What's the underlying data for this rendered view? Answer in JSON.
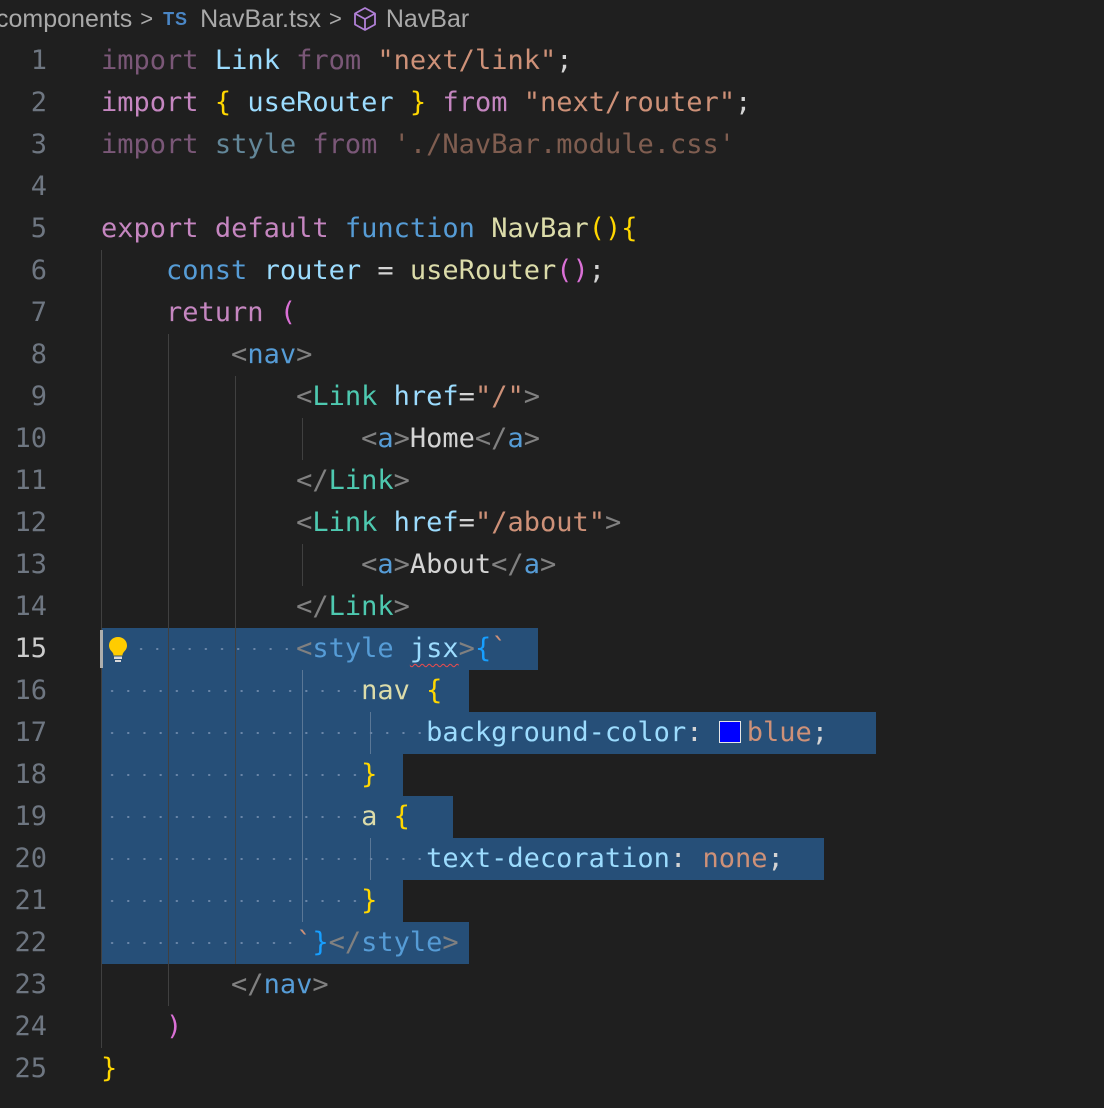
{
  "breadcrumb": {
    "folder": "components",
    "file_badge": "TS",
    "file": "NavBar.tsx",
    "symbol": "NavBar"
  },
  "editor": {
    "active_line": 15,
    "selection_color": "#264f78",
    "line_numbers": [
      "1",
      "2",
      "3",
      "4",
      "5",
      "6",
      "7",
      "8",
      "9",
      "10",
      "11",
      "12",
      "13",
      "14",
      "15",
      "16",
      "17",
      "18",
      "19",
      "20",
      "21",
      "22",
      "23",
      "24",
      "25"
    ],
    "lines": [
      [
        "import",
        " ",
        "Link",
        " ",
        "from",
        " ",
        "\"next/link\"",
        ";"
      ],
      [
        "import",
        " ",
        "{",
        " ",
        "useRouter",
        " ",
        "}",
        " ",
        "from",
        " ",
        "\"next/router\"",
        ";"
      ],
      [
        "import",
        " ",
        "style",
        " ",
        "from",
        " ",
        "'./NavBar.module.css'"
      ],
      [],
      [
        "export",
        " ",
        "default",
        " ",
        "function",
        " ",
        "NavBar",
        "(",
        ")",
        "{"
      ],
      [
        "    ",
        "const",
        " ",
        "router",
        " ",
        "=",
        " ",
        "useRouter",
        "(",
        ")",
        ";"
      ],
      [
        "    ",
        "return",
        " ",
        "("
      ],
      [
        "        ",
        "<",
        "nav",
        ">"
      ],
      [
        "            ",
        "<",
        "Link",
        " ",
        "href",
        "=",
        "\"/\"",
        ">"
      ],
      [
        "                ",
        "<",
        "a",
        ">",
        "Home",
        "</",
        "a",
        ">"
      ],
      [
        "            ",
        "</",
        "Link",
        ">"
      ],
      [
        "            ",
        "<",
        "Link",
        " ",
        "href",
        "=",
        "\"/about\"",
        ">"
      ],
      [
        "                ",
        "<",
        "a",
        ">",
        "About",
        "</",
        "a",
        ">"
      ],
      [
        "            ",
        "</",
        "Link",
        ">"
      ],
      [
        "            ",
        "<",
        "style",
        " ",
        "jsx",
        ">",
        "{",
        "`"
      ],
      [
        "                ",
        "nav",
        " ",
        "{"
      ],
      [
        "                    ",
        "background-color",
        ":",
        " ",
        "blue",
        ";"
      ],
      [
        "                ",
        "}"
      ],
      [
        "                ",
        "a",
        " ",
        "{"
      ],
      [
        "                    ",
        "text-decoration",
        ":",
        " ",
        "none",
        ";"
      ],
      [
        "                ",
        "}"
      ],
      [
        "            ",
        "`",
        "}",
        "</",
        "style",
        ">"
      ],
      [
        "        ",
        "</",
        "nav",
        ">"
      ],
      [
        "    ",
        ")"
      ],
      [
        "}"
      ]
    ],
    "classes": [
      [
        "kw dim",
        "",
        "vb",
        "",
        "kw dim",
        "",
        "st",
        "pn"
      ],
      [
        "kw",
        "",
        "b1",
        "",
        "vb",
        "",
        "b1",
        "",
        "kw",
        "",
        "st",
        "pn"
      ],
      [
        "kw dim",
        "",
        "vb dim",
        "",
        "kw dim",
        "",
        "st dim"
      ],
      [],
      [
        "kw",
        "",
        "kw",
        "",
        "kwb",
        "",
        "fn",
        "b1",
        "b1",
        "b1"
      ],
      [
        "",
        "kwb",
        "",
        "vb",
        "",
        "pn",
        "",
        "fn",
        "b2",
        "b2",
        "pn"
      ],
      [
        "",
        "kw",
        "",
        "b2"
      ],
      [
        "",
        "tp",
        "tg",
        "tp"
      ],
      [
        "",
        "tp",
        "cp",
        "",
        "vb",
        "pn",
        "st",
        "tp"
      ],
      [
        "",
        "tp",
        "tg",
        "tp",
        "pn",
        "tp",
        "tg",
        "tp"
      ],
      [
        "",
        "tp",
        "cp",
        "tp"
      ],
      [
        "",
        "tp",
        "cp",
        "",
        "vb",
        "pn",
        "st",
        "tp"
      ],
      [
        "",
        "tp",
        "tg",
        "tp",
        "pn",
        "tp",
        "tg",
        "tp"
      ],
      [
        "",
        "tp",
        "cp",
        "tp"
      ],
      [
        "",
        "tp",
        "tg",
        "",
        "vb squiggle",
        "tp",
        "b3",
        "st"
      ],
      [
        "",
        "fn",
        "",
        "b1"
      ],
      [
        "",
        "vb",
        "pn",
        "",
        "st",
        "pn"
      ],
      [
        "",
        "b1"
      ],
      [
        "",
        "fn",
        "",
        "b1"
      ],
      [
        "",
        "vb",
        "pn",
        "",
        "st",
        "pn"
      ],
      [
        "",
        "b1"
      ],
      [
        "",
        "st",
        "b3",
        "tp",
        "tg",
        "tp"
      ],
      [
        "",
        "tp",
        "tg",
        "tp"
      ],
      [
        "",
        "b2"
      ],
      [
        "b1"
      ]
    ]
  }
}
